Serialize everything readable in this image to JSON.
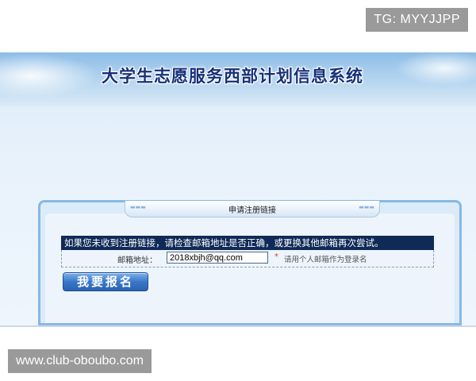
{
  "overlay": {
    "tg_label": "TG: MYYJJPP",
    "site_label": "www.club-oboubo.com"
  },
  "banner": {
    "title": "大学生志愿服务西部计划信息系统"
  },
  "panel": {
    "title": "申请注册链接",
    "notice": "如果您未收到注册链接，请检查邮箱地址是否正确，或更换其他邮箱再次尝试。",
    "email_label": "邮箱地址：",
    "email_value": "2018xbjh@qq.com",
    "required_mark": "*",
    "email_hint": "请用个人邮箱作为登录名",
    "submit_label": "我要报名"
  },
  "colors": {
    "title_text": "#16307a",
    "notice_bg": "#0f2a57",
    "button_blue": "#3978c8",
    "panel_border": "#86b9e4",
    "required": "#d43a2a"
  }
}
